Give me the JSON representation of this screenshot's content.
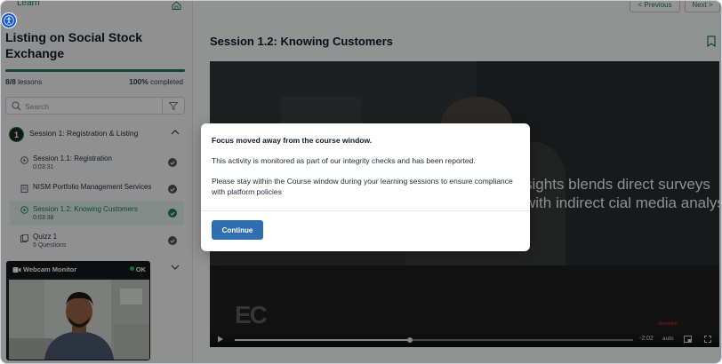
{
  "sidebar": {
    "learn_label": "Learn",
    "course_title": "Listing on Social Stock Exchange",
    "lessons_done": "8/8",
    "lessons_label": "lessons",
    "progress_percent": 100,
    "progress_text": "100%",
    "completed_label": "completed",
    "search": {
      "placeholder": "Search"
    },
    "session": {
      "number": "1",
      "title": "Session 1: Registration & Listing"
    },
    "lessons": [
      {
        "title": "Session 1.1: Registration",
        "subtitle": "0:03:31",
        "type": "video",
        "completed": true
      },
      {
        "title": "NISM Portfolio Management Services",
        "subtitle": "",
        "type": "document",
        "completed": true
      },
      {
        "title": "Session 1.2: Knowing Customers",
        "subtitle": "0:03:38",
        "type": "video",
        "completed": true,
        "active": true
      },
      {
        "title": "Quizz 1",
        "subtitle": "5 Questions",
        "type": "quiz",
        "completed": true
      }
    ]
  },
  "webcam": {
    "title": "Webcam Monitor",
    "status": "OK",
    "status_color": "#22c55e"
  },
  "main": {
    "prev_label": "< Previous",
    "next_label": "Next >",
    "lesson_heading": "Session 1.2: Knowing Customers",
    "video": {
      "caption": "sights blends direct surveys with indirect cial media analysis",
      "logo_text": "EC",
      "brand_text": "ekochain",
      "time_remaining": "-2:02",
      "quality": "auto",
      "progress_fraction": 0.44
    }
  },
  "modal": {
    "title": "Focus moved away from the course window.",
    "text1": "This activity is monitored as part of our integrity checks and has been reported.",
    "text2": "Please stay within the Course window during your learning sessions to ensure compliance with platform policies",
    "button": "Continue"
  },
  "colors": {
    "accent": "#1f7a55",
    "button": "#2f6fb0"
  }
}
